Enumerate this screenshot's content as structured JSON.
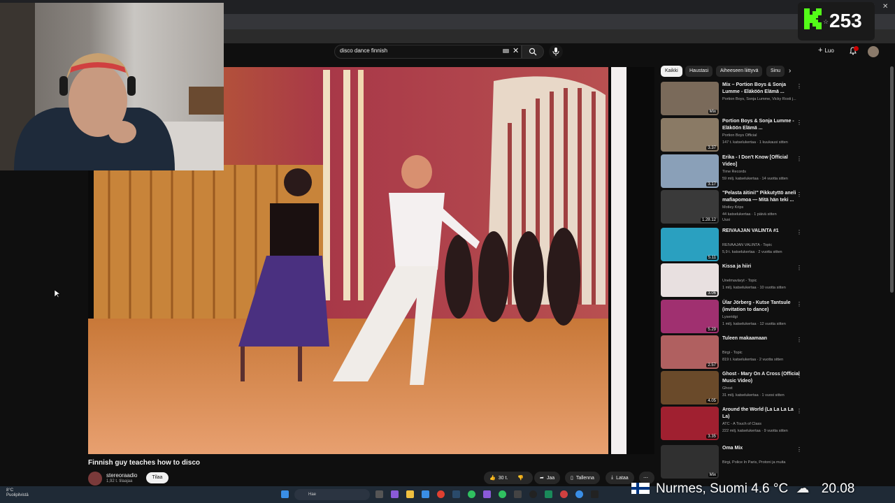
{
  "browser": {
    "window_controls": [
      "–",
      "▢",
      "✕"
    ]
  },
  "header": {
    "search_query": "disco dance finnish",
    "create_label": "Luo"
  },
  "kick": {
    "viewer_count": "253",
    "brand_color": "#53fc18"
  },
  "video": {
    "title": "Finnish guy teaches how to disco",
    "channel": "stereoraadio",
    "subscribers": "1,92 t. tilaajaa",
    "subscribe_label": "Tilaa",
    "actions": {
      "likes": "30 t.",
      "share": "Jaa",
      "save": "Tallenna",
      "download": "Lataa"
    }
  },
  "chips": [
    "Kaikki",
    "Haustasi",
    "Aiheeseen liittyvä",
    "Sinu"
  ],
  "recommendations": [
    {
      "title": "Mix – Portion Boys & Sonja Lumme - Eläköön Elämä ...",
      "meta1": "Portion Boys, Sonja Lumme, Vicky Rosti j...",
      "meta2": "",
      "duration": "Mix",
      "thumb": "#7a6a5a"
    },
    {
      "title": "Portion Boys & Sonja Lumme - Eläköön Elämä ...",
      "meta1": "Portion Boys Official",
      "meta2": "147 t. katselukertaa · 1 kuukausi sitten",
      "duration": "3.37",
      "thumb": "#8a7a65"
    },
    {
      "title": "Erika - I Don't Know [Official Video]",
      "meta1": "Time Records",
      "meta2": "59 milj. katselukertaa · 14 vuotta sitten",
      "duration": "3.17",
      "thumb": "#8aa0b8"
    },
    {
      "title": "\"Pelasta äitini!\" Pikkutyttö aneli mafiapomoa — Mitä hän teki ...",
      "meta1": "Motley Krips",
      "meta2": "44 katselukertaa · 1 päivä sitten",
      "meta3": "Uusi",
      "duration": "1.28.12",
      "thumb": "#3a3a3a"
    },
    {
      "title": "REIVAAJAN VALINTA #1",
      "meta1": "REIVAAJAN VALINTA - Topic",
      "meta2": "5,9 t. katselukertaa · 2 vuotta sitten",
      "duration": "5.11",
      "thumb": "#2aa0c0"
    },
    {
      "title": "Kissa ja hiiri",
      "meta1": "Unelmavävyt - Topic",
      "meta2": "1 milj. katselukertaa · 10 vuotta sitten",
      "duration": "3.06",
      "thumb": "#e8e0e0"
    },
    {
      "title": "Ülar Jörberg - Kutse Tantsule (invitation to dance)",
      "meta1": "Lyseridgi",
      "meta2": "1 milj. katselukertaa · 12 vuotta sitten",
      "duration": "5.29",
      "thumb": "#a03070"
    },
    {
      "title": "Tuleen makaamaan",
      "meta1": "Birgi - Topic",
      "meta2": "819 t. katselukertaa · 2 vuotta sitten",
      "duration": "2.57",
      "thumb": "#b06060"
    },
    {
      "title": "Ghost - Mary On A Cross (Official Music Video)",
      "meta1": "Ghost",
      "meta2": "31 milj. katselukertaa · 1 vuosi sitten",
      "duration": "4.05",
      "thumb": "#6a4a2a"
    },
    {
      "title": "Around the World (La La La La La)",
      "meta1": "ATC - A Touch of Class",
      "meta2": "222 milj. katselukertaa · 9 vuotta sitten",
      "duration": "3.35",
      "thumb": "#a02030"
    },
    {
      "title": "Oma Mix",
      "meta1": "Birgi, Police In Paris, Protoni ja muita",
      "meta2": "",
      "duration": "Mix",
      "thumb": "#303030"
    }
  ],
  "taskbar": {
    "weather_temp": "8°C",
    "weather_desc": "Puolipilvistä",
    "search_placeholder": "Hae"
  },
  "overlay": {
    "location_weather": "Nurmes, Suomi  4.6 °C",
    "time": "20.08"
  }
}
